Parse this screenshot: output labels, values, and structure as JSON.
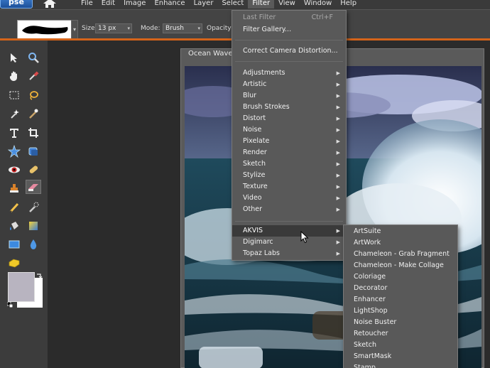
{
  "app": {
    "logo": "pse"
  },
  "menubar": {
    "items": [
      "File",
      "Edit",
      "Image",
      "Enhance",
      "Layer",
      "Select",
      "Filter",
      "View",
      "Window",
      "Help"
    ],
    "active_index": 6
  },
  "options": {
    "size_label": "Size:",
    "size_value": "13 px",
    "mode_label": "Mode:",
    "mode_value": "Brush",
    "opacity_label": "Opacity:"
  },
  "document": {
    "title": "Ocean Wave"
  },
  "filter_menu": {
    "last_filter": {
      "label": "Last Filter",
      "shortcut": "Ctrl+F"
    },
    "filter_gallery": "Filter Gallery...",
    "correct_camera": "Correct Camera Distortion...",
    "groups": [
      "Adjustments",
      "Artistic",
      "Blur",
      "Brush Strokes",
      "Distort",
      "Noise",
      "Pixelate",
      "Render",
      "Sketch",
      "Stylize",
      "Texture",
      "Video",
      "Other"
    ],
    "plugins": [
      "AKVIS",
      "Digimarc",
      "Topaz Labs"
    ],
    "highlighted": "AKVIS"
  },
  "akvis_submenu": {
    "items": [
      "ArtSuite",
      "ArtWork",
      "Chameleon - Grab Fragment",
      "Chameleon - Make Collage",
      "Coloriage",
      "Decorator",
      "Enhancer",
      "LightShop",
      "Noise Buster",
      "Retoucher",
      "Sketch",
      "SmartMask",
      "Stamp"
    ]
  },
  "colors": {
    "accent_orange": "#d5641a",
    "menu_bg": "#595959",
    "highlight_bg": "#3a3a3a",
    "foreground_swatch": "#b8b4c0",
    "background_swatch": "#ffffff"
  },
  "icons": {
    "tools": [
      "move-icon",
      "zoom-icon",
      "hand-icon",
      "eyedropper-icon",
      "marquee-icon",
      "lasso-icon",
      "magic-wand-icon",
      "quick-selection-icon",
      "type-icon",
      "crop-icon",
      "shape-star-icon",
      "cookie-cutter-icon",
      "red-eye-icon",
      "healing-icon",
      "clone-stamp-icon",
      "eraser-icon",
      "pencil-icon",
      "smart-brush-icon",
      "paint-bucket-icon",
      "gradient-icon",
      "rectangle-shape-icon",
      "blur-icon",
      "sponge-icon"
    ]
  }
}
